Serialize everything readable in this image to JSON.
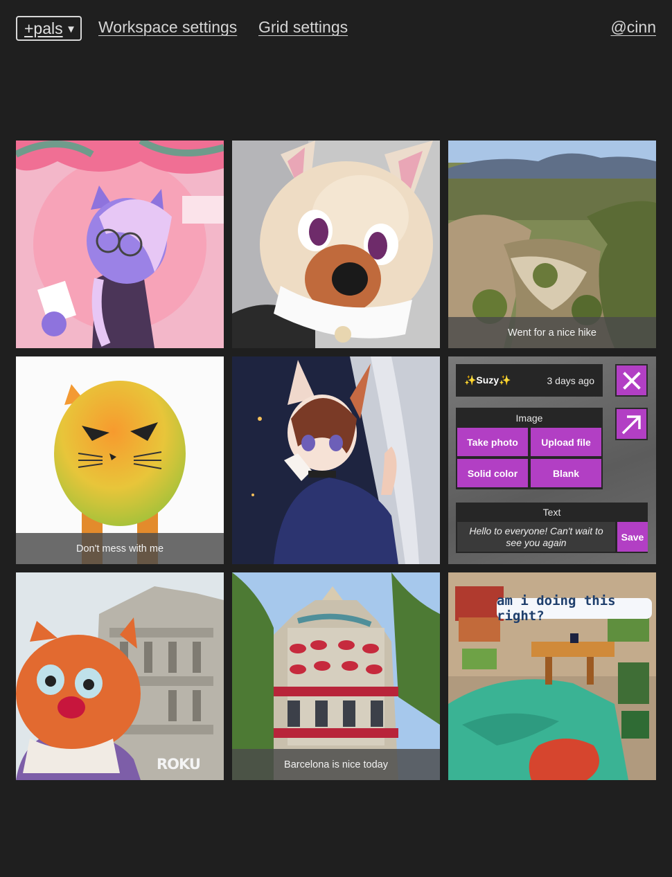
{
  "nav": {
    "workspace_select": "+pals",
    "workspace_settings": "Workspace settings",
    "grid_settings": "Grid settings",
    "user": "@cinn"
  },
  "tiles": {
    "t3_caption": "Went for a nice hike",
    "t4_caption": "Don't mess with me",
    "t7_watermark": "ROKU",
    "t8_caption": "Barcelona is nice today",
    "t9_bubble": "am i doing this right?"
  },
  "editor": {
    "author": "✨Suzy✨",
    "time": "3 days ago",
    "image_title": "Image",
    "take_photo": "Take photo",
    "upload_file": "Upload file",
    "solid_color": "Solid color",
    "blank": "Blank",
    "text_title": "Text",
    "text_value": "Hello to everyone!  Can't wait to see you again",
    "save": "Save",
    "accent_color": "#b23fc4",
    "close_icon": "close-icon",
    "open_icon": "arrow-up-right-icon"
  },
  "colors": {
    "background": "#1f1f1f",
    "panel": "#262626"
  }
}
